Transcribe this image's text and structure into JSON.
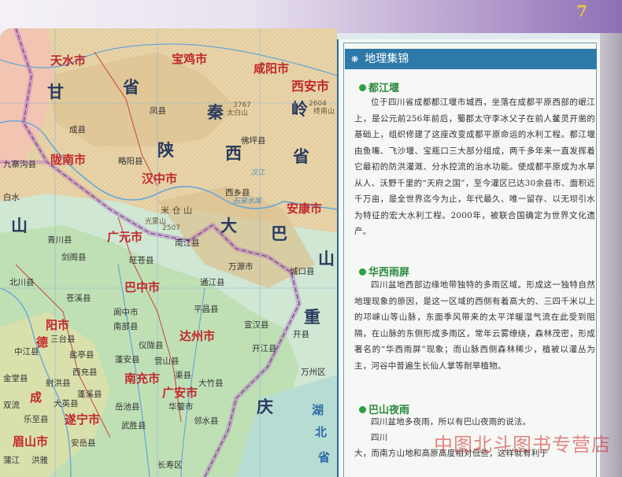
{
  "page_number": "7",
  "map": {
    "regions": {
      "shaanxi_1": "省",
      "shaanxi_2": "陕",
      "shaanxi_3": "西",
      "shaanxi_4": "省",
      "qinling_1": "秦",
      "qinling_2": "岭",
      "daba_1": "大",
      "daba_2": "巴",
      "daba_3": "山",
      "chongqing_1": "重",
      "chongqing_2": "庆",
      "hubei_1": "湖",
      "hubei_2": "北",
      "hubei_3": "省",
      "left_1": "甘",
      "left_2": "山"
    },
    "cities": {
      "tianshui": "天水市",
      "baoji": "宝鸡市",
      "xianyang": "咸阳市",
      "xian": "西安市",
      "longnan": "陇南市",
      "hanzhong": "汉中市",
      "ankang": "安康市",
      "guangyuan": "广元市",
      "bazhong": "巴中市",
      "dazhou": "达州市",
      "nanchong": "南充市",
      "guangan": "广安市",
      "suining": "遂宁市",
      "mianyang": "阳市",
      "chengdu": "成",
      "meishan": "眉山市",
      "de": "德"
    },
    "counties": {
      "fengxian": "凤县",
      "liuba": "留坝",
      "huixian": "徽县",
      "chengxian": "成县",
      "lueyang": "略阳县",
      "foping": "佛坪县",
      "jiuzhaigou": "九寨沟县",
      "wenxian": "文县",
      "xixiang": "西乡县",
      "qingchuan": "青川县",
      "jiange": "剑阁县",
      "wangcang": "旺苍县",
      "nanjiang": "南江县",
      "wanyuan": "万源市",
      "chengkou": "城口县",
      "beichuan": "北川县",
      "zitong": "梓潼县",
      "cangxi": "苍溪县",
      "langzhong": "阆中市",
      "tongjiang": "通江县",
      "pingchang": "平昌县",
      "xuanhan": "宣汉县",
      "kaixian": "开江县",
      "kaixian2": "开县",
      "yanting": "盐亭县",
      "nanbu": "南部县",
      "yilong": "仪陇县",
      "yingshan": "营山县",
      "quxian": "渠县",
      "dazhu": "大竹县",
      "xichong": "西充县",
      "pengan": "蓬安县",
      "shehong": "射洪县",
      "dayng": "大英县",
      "pengxi": "蓬溪县",
      "yuechi": "岳池县",
      "huaying": "华蓥市",
      "linshui": "邻水县",
      "wusheng": "武胜县",
      "changshou": "长寿区",
      "wanzhou": "万州区",
      "zhongjiang": "中江县",
      "santai": "三台县",
      "jintang": "金堂县",
      "lezhi": "乐至县",
      "anyue": "安岳县",
      "shuangliu": "双流",
      "pujiang": "蒲江",
      "hongya": "洪雅",
      "baishui": "白水",
      "dongbaoshan": "东宝山"
    },
    "labels": {
      "peak_1": "3767",
      "peak_1_name": "太白山",
      "peak_2": "2604",
      "peak_2_name": "终南山",
      "peak_3": "2507",
      "peak_3_name": "光雾山",
      "river_han": "汉江",
      "river_shiquan": "石泉水库",
      "mi_cang": "米 仓 山"
    }
  },
  "panel": {
    "header": "地理集锦",
    "sections": [
      {
        "title": "都江堰",
        "text": "位于四川省成都都江堰市城西，坐落在成都平原西部的岷江上，是公元前256年前后，蜀郡太守李冰父子在前人鳖灵开凿的基础上，组织修建了这座改变成都平原命运的水利工程。都江堰由鱼嘴、飞沙堰、宝瓶口三大部分组成，两千多年来一直发挥着它最初的防洪灌溉、分水控流的治水功能。使成都平原成为水旱从人、沃野千里的“天府之国”，至今灌区已达30余县市、面积近千万亩，是全世界迄今为止，年代最久、唯一留存、以无坝引水为特征的宏大水利工程。2000年，被联合国确定为世界文化遗产。"
      },
      {
        "title": "华西雨屏",
        "text": "四川盆地西部边缘地带独特的多雨区域。形成这一独特自然地理现象的原因，是这一区域的西侧有着高大的、三四千米以上的邛崃山等山脉，东面季风带来的太平洋暖湿气流在此受到阻隔，在山脉的东侧形成多雨区，常年云雾缭绕，森林茂密，形成著名的“华西雨屏”现象；而山脉西侧森林稀少，植被以灌丛为主，河谷中普遍生长仙人掌等耐旱植物。"
      },
      {
        "title": "巴山夜雨",
        "text": "四川盆地多夜雨，所以有巴山夜雨的说法。"
      }
    ],
    "tail_line_1": "四川",
    "tail_line_2": "大，而南方山地和高原高度相对低些，这样就有利于"
  },
  "watermark": "中图北斗图书专营店"
}
